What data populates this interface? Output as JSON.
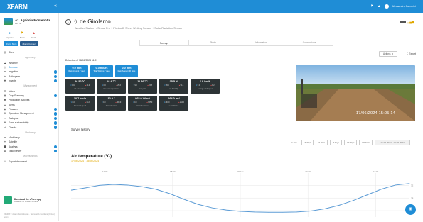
{
  "app": {
    "logo": "XFARM",
    "collapse_icon": "double-chevron-left"
  },
  "topbar": {
    "user_name": "Alessandro Camerini",
    "icons": [
      "bell-icon",
      "warning-icon",
      "user-icon"
    ]
  },
  "sidebar": {
    "farm_name": "Az. Agricola Montenotte",
    "farm_sub": "220 ha",
    "quick": [
      {
        "label": "Expense",
        "icon": "coin-icon",
        "tone": "blue"
      },
      {
        "label": "News",
        "icon": "flag-icon",
        "tone": "gold"
      },
      {
        "label": "Alerts",
        "icon": "alert-icon",
        "tone": "red"
      }
    ],
    "badges": [
      {
        "label": "xFarm Store",
        "tone": "blue"
      },
      {
        "label": "xFarm Connect",
        "tone": "dark"
      }
    ],
    "nav": [
      {
        "type": "item",
        "label": "Sites",
        "icon": "map-icon"
      },
      {
        "type": "section",
        "label": "Agronomy"
      },
      {
        "type": "item",
        "label": "Weather",
        "icon": "cloud-icon"
      },
      {
        "type": "item",
        "label": "Sensors",
        "icon": "sensor-icon",
        "active": true
      },
      {
        "type": "item",
        "label": "Irrigation",
        "icon": "drop-icon",
        "dot": true
      },
      {
        "type": "item",
        "label": "Pathogens",
        "icon": "bug-icon",
        "dot": true
      },
      {
        "type": "item",
        "label": "Insects",
        "icon": "insect-icon",
        "dot": true
      },
      {
        "type": "section",
        "label": "Management"
      },
      {
        "type": "item",
        "label": "Notes",
        "icon": "note-icon"
      },
      {
        "type": "item",
        "label": "Crop Planning",
        "icon": "calendar-icon",
        "dot": true
      },
      {
        "type": "item",
        "label": "Production Batches",
        "icon": "box-icon"
      },
      {
        "type": "item",
        "label": "Alerts",
        "icon": "bell-icon"
      },
      {
        "type": "item",
        "label": "Finances",
        "icon": "money-icon",
        "dot": true
      },
      {
        "type": "item",
        "label": "Operation Management",
        "icon": "gear-icon",
        "dot": true
      },
      {
        "type": "item",
        "label": "Task plan",
        "icon": "list-icon",
        "dot": true
      },
      {
        "type": "item",
        "label": "Farm sustainability",
        "icon": "leaf-icon",
        "dot": true
      },
      {
        "type": "item",
        "label": "Checks",
        "icon": "check-icon",
        "dot": true
      },
      {
        "type": "section",
        "label": "Machinery"
      },
      {
        "type": "item",
        "label": "Machinery",
        "icon": "tractor-icon"
      },
      {
        "type": "item",
        "label": "Satellite",
        "icon": "satellite-icon"
      },
      {
        "type": "item",
        "label": "Analysis",
        "icon": "chart-icon",
        "dot": true
      },
      {
        "type": "item",
        "label": "Task Viewer",
        "icon": "eye-icon",
        "dot": true
      },
      {
        "type": "section",
        "label": "Miscellaneous"
      },
      {
        "type": "item",
        "label": "Export document",
        "icon": "export-icon"
      }
    ],
    "download_title": "Download the xFarm app",
    "download_sub": "Available for iOS and Android",
    "footer": "XFARM © xFarm Technologies · Terms and conditions | Privacy policy"
  },
  "header": {
    "back_icon": "back-arrow-icon",
    "signal_icon": "wifi-icon",
    "title": "de Girolamo",
    "subtitle": "Weather Station | xSense Pro + Phytos31 Sheet Wetting Sensor + Solar Radiation Sensor",
    "battery_icon": "battery-icon",
    "signal_bars_icon": "signal-icon"
  },
  "tabs": [
    {
      "label": "Surveys",
      "active": true
    },
    {
      "label": "Photo",
      "active": false
    },
    {
      "label": "Information",
      "active": false
    },
    {
      "label": "Connections",
      "active": false
    }
  ],
  "toolbar": {
    "actions_label": "Actions",
    "export_label": "Export"
  },
  "detection": {
    "label": "Detection of 18/06/2024 11:01"
  },
  "blue_cards": [
    {
      "value": "0.0 mm",
      "label": "Rain Amount 7 days"
    },
    {
      "value": "0.0 hours",
      "label": "Total Wetting 7 days"
    },
    {
      "value": "0.0 mm",
      "label": "Rain Amount 30 days"
    }
  ],
  "dark_cards": [
    {
      "value": "26.52 °C",
      "min": "16.8",
      "max": "34.0",
      "label": "Air temperature"
    },
    {
      "value": "18.4 °C",
      "min": "0.0",
      "max": "25.6",
      "label": "Min soil temperature"
    },
    {
      "value": "11.86 °C",
      "min": "9.0",
      "max": "15.8",
      "label": "Dew point"
    },
    {
      "value": "35.5 %",
      "min": "35.5",
      "max": "94.5",
      "label": "Air humidity"
    },
    {
      "value": "6.0 km/h",
      "min": "0.0",
      "max": "8.2",
      "label": "Average wind speed"
    },
    {
      "value": "10.7 km/h",
      "min": "0.0",
      "max": "11.2",
      "label": "Max wind speed"
    },
    {
      "value": "12.0 °",
      "min": "0.0",
      "max": "360.0",
      "label": "Wind direction"
    },
    {
      "value": "865.0 W/m2",
      "min": "0.0",
      "max": "965.0",
      "label": "Solar Radiation"
    },
    {
      "value": "264.0 mV",
      "min": "264.0",
      "max": "264.0",
      "label": "Leaf Wetting"
    }
  ],
  "photo": {
    "timestamp": "17/06/2024 15:05:14"
  },
  "survey_history": {
    "title": "Survey history",
    "ranges": [
      "1 day",
      "2 days",
      "3 days",
      "7 days",
      "30 days",
      "90 days"
    ],
    "date_range": "16-06-2024 - 18-06-2024"
  },
  "help_icon": "help-icon",
  "chart_data": {
    "type": "line",
    "title": "Air temperature (°C)",
    "subtitle": "17/06/2024 - 18/06/2024",
    "x_tick_labels": [
      "12:00",
      "18:00",
      "18 Jun",
      "06:00",
      "12:00"
    ],
    "x": [
      0,
      1,
      2,
      3,
      4,
      5,
      6,
      7,
      8,
      9,
      10,
      11,
      12,
      13,
      14,
      15,
      16,
      17,
      18,
      19,
      20,
      21,
      22,
      23,
      24
    ],
    "y_tick_labels": [
      "32",
      "28",
      "24"
    ],
    "ylim": [
      22,
      35
    ],
    "series": [
      {
        "name": "",
        "color": "#5b9bd5",
        "values": [
          30.5,
          31.2,
          32.0,
          32.3,
          32.1,
          31.6,
          30.8,
          29.4,
          27.6,
          26.0,
          24.9,
          24.2,
          23.8,
          23.6,
          23.5,
          23.5,
          23.6,
          23.9,
          24.6,
          25.7,
          27.2,
          29.0,
          30.8,
          32.1,
          32.6
        ]
      }
    ],
    "grid": true
  }
}
